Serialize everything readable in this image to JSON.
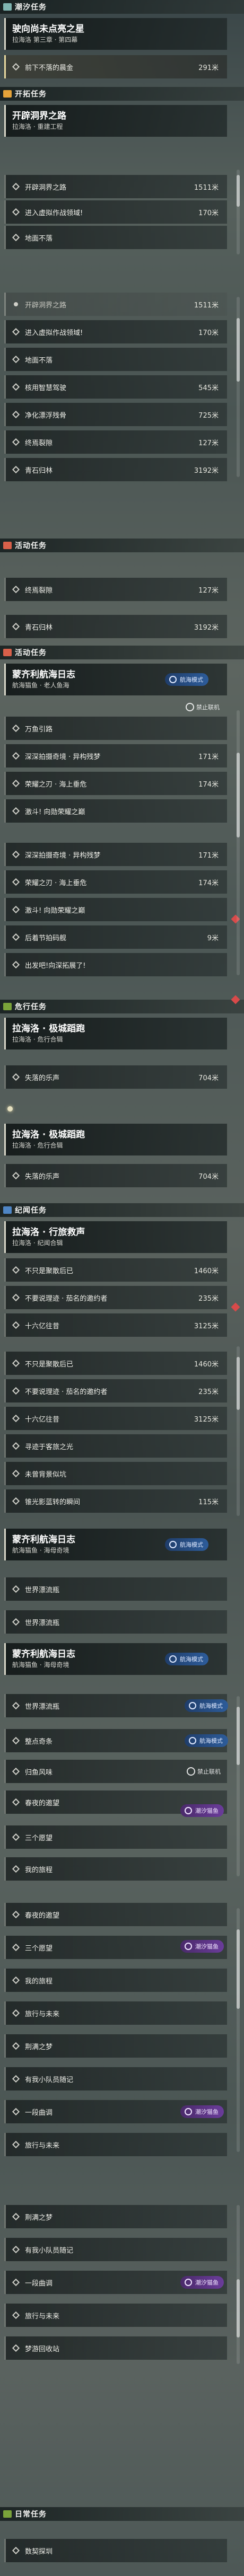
{
  "sections": [
    {
      "id": "s1",
      "label": "潮汐任务",
      "color": "#7fb4b0"
    },
    {
      "id": "s2",
      "label": "开拓任务",
      "color": "#e6a33a"
    },
    {
      "id": "s3",
      "label": "活动任务",
      "color": "#d9604a"
    },
    {
      "id": "s4",
      "label": "活动任务",
      "color": "#d9604a"
    },
    {
      "id": "s5",
      "label": "危行任务",
      "color": "#7aa33a"
    },
    {
      "id": "s6",
      "label": "纪闻任务",
      "color": "#4f86c6"
    },
    {
      "id": "s7",
      "label": "日常任务",
      "color": "#7aa33a"
    }
  ],
  "quests": [
    {
      "id": "q1",
      "title": "驶向尚未点亮之星",
      "sub": "拉海洛 第三章 · 第四幕"
    },
    {
      "id": "q2",
      "title": "开辟洞界之路",
      "sub": "拉海洛 · 重建工程"
    },
    {
      "id": "q3",
      "title": "蒙齐利航海日志",
      "sub": "航海猫鱼 · 老人鱼海"
    },
    {
      "id": "q4",
      "title": "拉海洛 · 极城蹈跑",
      "sub": "拉海洛 · 危行合辑"
    },
    {
      "id": "q5",
      "title": "拉海洛 · 极城蹈跑",
      "sub": "拉海洛 · 危行合辑"
    },
    {
      "id": "q6",
      "title": "拉海洛 · 行旅救声",
      "sub": "拉海洛 · 纪闻合辑"
    },
    {
      "id": "q7",
      "title": "蒙齐利航海日志",
      "sub": "航海猫鱼 · 海母奇境"
    },
    {
      "id": "q8",
      "title": "蒙齐利航海日志",
      "sub": "航海猫鱼 · 海母奇境"
    }
  ],
  "steps": {
    "a1": {
      "text": "前下不落的晨金",
      "dist": "291米"
    },
    "b1": {
      "text": "开辟洞界之路",
      "dist": "1511米"
    },
    "b2": {
      "text": "进入虚拟作战领域!",
      "dist": "170米"
    },
    "b3": {
      "text": "地面不落",
      "dist": ""
    },
    "c1": {
      "text": "开辟洞界之路",
      "dist": "1511米"
    },
    "c2": {
      "text": "进入虚拟作战领域!",
      "dist": "170米"
    },
    "c3": {
      "text": "地面不落",
      "dist": ""
    },
    "c4": {
      "text": "核用智慧驾驶",
      "dist": "545米"
    },
    "c5": {
      "text": "净化漂浮残骨",
      "dist": "725米"
    },
    "c6": {
      "text": "终焉裂隙",
      "dist": "127米"
    },
    "c7": {
      "text": "青石归林",
      "dist": "3192米"
    },
    "d1": {
      "text": "终焉裂隙",
      "dist": "127米"
    },
    "d2": {
      "text": "青石归林",
      "dist": "3192米"
    },
    "e1": {
      "text": "万鱼引路",
      "dist": ""
    },
    "e2": {
      "text": "深深拍摄奇境 · 异构残梦",
      "dist": "171米"
    },
    "e3": {
      "text": "荣耀之刃 · 海上垂危",
      "dist": "174米"
    },
    "e4": {
      "text": "激斗! 向勋荣耀之巅",
      "dist": ""
    },
    "e5": {
      "text": "深深拍摄奇境 · 异构残梦",
      "dist": "171米"
    },
    "e6": {
      "text": "荣耀之刃 · 海上垂危",
      "dist": "174米"
    },
    "e7": {
      "text": "激斗! 向勋荣耀之巅",
      "dist": ""
    },
    "e8": {
      "text": "后着节拍码舰",
      "dist": "9米"
    },
    "e9": {
      "text": "出发吧!向深拓展了!",
      "dist": ""
    },
    "f1": {
      "text": "失落的乐声",
      "dist": "704米"
    },
    "g1": {
      "text": "失落的乐声",
      "dist": "704米"
    },
    "h1": {
      "text": "不只是聚散后已",
      "dist": "1460米"
    },
    "h2": {
      "text": "不要说理迹 · 茄名的邀约者",
      "dist": "235米"
    },
    "h3": {
      "text": "十六亿往昔",
      "dist": "3125米"
    },
    "i1": {
      "text": "不只是聚散后已",
      "dist": "1460米"
    },
    "i2": {
      "text": "不要说理迹 · 茄名的邀约者",
      "dist": "235米"
    },
    "i3": {
      "text": "十六亿往昔",
      "dist": "3125米"
    },
    "i4": {
      "text": "寻迹于客旅之光",
      "dist": ""
    },
    "i5": {
      "text": "未曾背景似坑",
      "dist": ""
    },
    "i6": {
      "text": "锥光影蓝转的瞬间",
      "dist": "115米"
    },
    "j1": {
      "text": "世界漂流瓶",
      "dist": ""
    },
    "j2": {
      "text": "世界漂流瓶",
      "dist": ""
    },
    "k1": {
      "text": "世界漂流瓶",
      "dist": ""
    },
    "k2": {
      "text": "整点奇条",
      "dist": ""
    },
    "k3": {
      "text": "归鱼风味",
      "dist": ""
    },
    "k4": {
      "text": "春夜的邀望",
      "dist": ""
    },
    "k5": {
      "text": "三个愿望",
      "dist": ""
    },
    "k6": {
      "text": "我的旅程",
      "dist": ""
    },
    "l1": {
      "text": "春夜的邀望",
      "dist": ""
    },
    "l2": {
      "text": "三个愿望",
      "dist": ""
    },
    "l3": {
      "text": "我的旅程",
      "dist": ""
    },
    "l4": {
      "text": "旅行与未来",
      "dist": ""
    },
    "l5": {
      "text": "荆满之梦",
      "dist": ""
    },
    "l6": {
      "text": "有我小队员随记",
      "dist": ""
    },
    "l7": {
      "text": "一段曲调",
      "dist": ""
    },
    "l8": {
      "text": "旅行与未来",
      "dist": ""
    },
    "m1": {
      "text": "荆满之梦",
      "dist": ""
    },
    "m2": {
      "text": "有我小队员随记",
      "dist": ""
    },
    "m3": {
      "text": "一段曲调",
      "dist": ""
    },
    "m4": {
      "text": "旅行与未来",
      "dist": ""
    },
    "m5": {
      "text": "梦游回收站",
      "dist": ""
    },
    "n1": {
      "text": "数契探圳",
      "dist": ""
    }
  },
  "tracking": {
    "blue": "航海模式",
    "purple": "潮汐猫鱼"
  },
  "watermark": "禁止联机",
  "colors": {
    "accent": "#e8d9a0",
    "tracking_blue": "#2d5c9a",
    "tracking_purple": "#6a3c9a",
    "alert": "#d84a4a"
  }
}
